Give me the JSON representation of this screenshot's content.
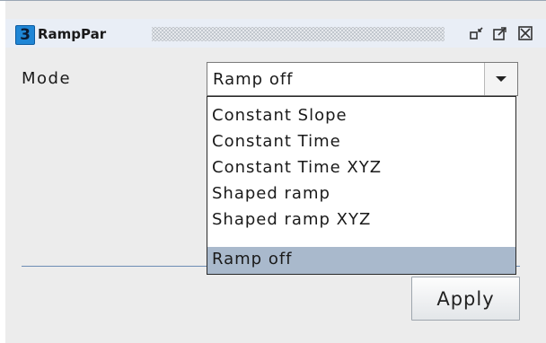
{
  "window": {
    "number": "3",
    "title": "RampPar"
  },
  "form": {
    "mode_label": "Mode",
    "mode_value": "Ramp off"
  },
  "dropdown": {
    "options": [
      "Constant Slope",
      "Constant Time",
      "Constant Time XYZ",
      "Shaped ramp",
      "Shaped ramp XYZ",
      "Ramp off"
    ],
    "selected_index": 5
  },
  "actions": {
    "apply_label": "Apply"
  },
  "colors": {
    "title_badge": "#1f86d6",
    "selection": "#a9b9cc",
    "separator": "#6e8db4"
  }
}
